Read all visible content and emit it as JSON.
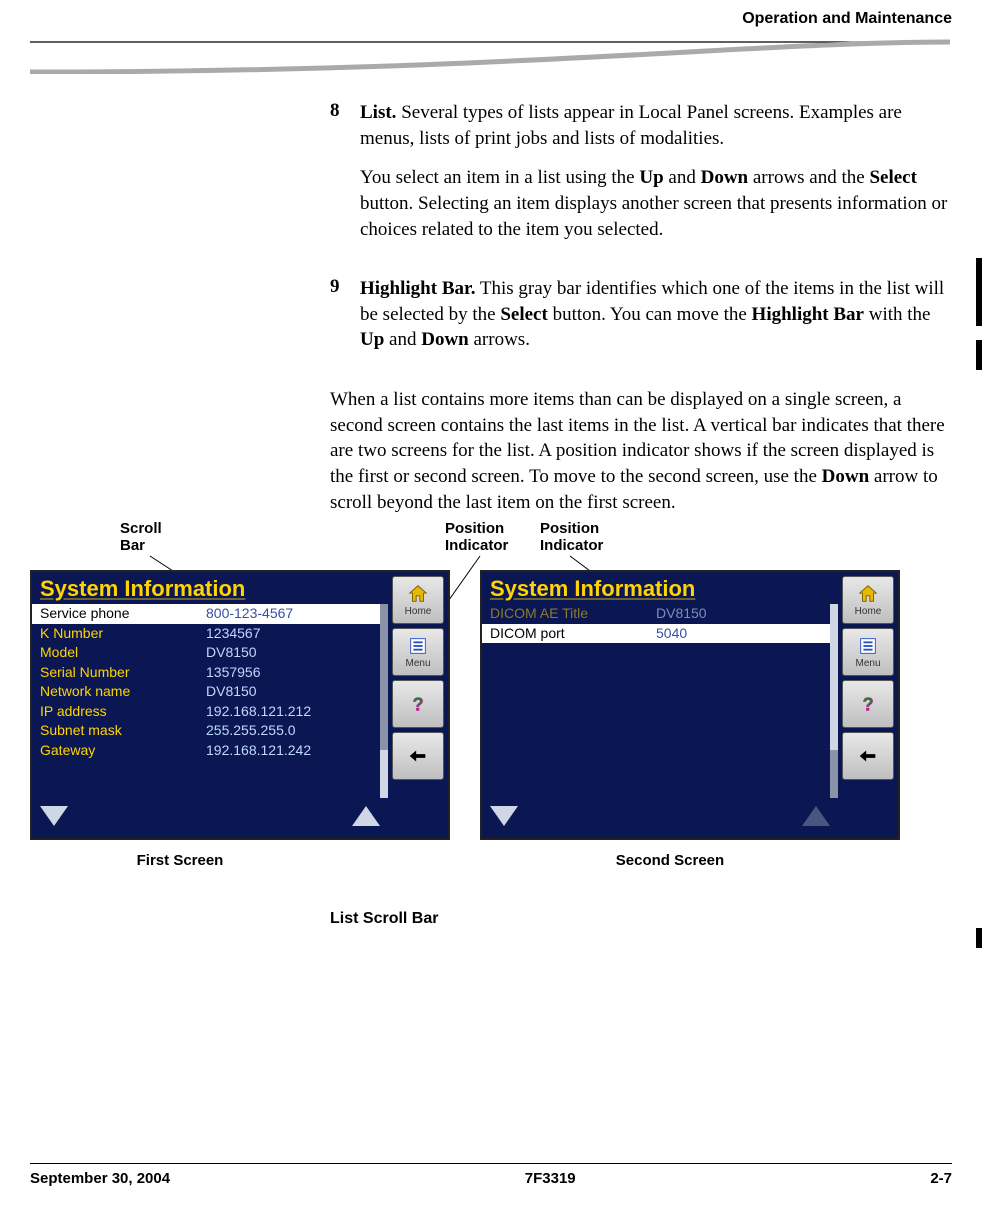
{
  "header": {
    "title": "Operation and Maintenance"
  },
  "items": {
    "item8": {
      "num": "8",
      "title": "List.",
      "p1_rest": " Several types of lists appear in Local Panel screens. Examples are menus, lists of print jobs and lists of modalities.",
      "p2_a": "You select an item in a list using the ",
      "p2_up": "Up",
      "p2_b": " and ",
      "p2_down": "Down",
      "p2_c": " arrows and the ",
      "p2_select": "Select",
      "p2_d": " button. Selecting an item displays another screen that presents information or choices related to the item you selected."
    },
    "item9": {
      "num": "9",
      "title": "Highlight Bar.",
      "p1_a": " This gray bar identifies which one of the items in the list will be selected by the ",
      "p1_select": "Select",
      "p1_b": " button. You can move the ",
      "p1_hb": "Highlight Bar",
      "p1_c": " with the ",
      "p1_up": "Up",
      "p1_d": " and ",
      "p1_down": "Down",
      "p1_e": " arrows."
    },
    "para": {
      "a": "When a list contains more items than can be displayed on a single screen, a second screen contains the last items in the list. A vertical bar indicates that there are two screens for the list. A position indicator shows if the screen displayed is the first or second screen. To move to the second screen, use the ",
      "down": "Down",
      "b": " arrow to scroll beyond the last item on the first screen."
    }
  },
  "callouts": {
    "scroll_bar_l1": "Scroll",
    "scroll_bar_l2": "Bar",
    "pos_ind1_l1": "Position",
    "pos_ind1_l2": "Indicator",
    "pos_ind2_l1": "Position",
    "pos_ind2_l2": "Indicator"
  },
  "screens": {
    "first": {
      "title": "System Information",
      "rows": [
        {
          "label": "Service phone",
          "value": "800-123-4567",
          "selected": true
        },
        {
          "label": "K Number",
          "value": "1234567"
        },
        {
          "label": "Model",
          "value": "DV8150"
        },
        {
          "label": "Serial Number",
          "value": "1357956"
        },
        {
          "label": "Network name",
          "value": "DV8150"
        },
        {
          "label": "IP address",
          "value": "192.168.121.212"
        },
        {
          "label": "Subnet mask",
          "value": "255.255.255.0"
        },
        {
          "label": "Gateway",
          "value": "192.168.121.242"
        }
      ],
      "caption": "First Screen"
    },
    "second": {
      "title": "System Information",
      "rows": [
        {
          "label": "DICOM AE Title",
          "value": "DV8150",
          "dim": true
        },
        {
          "label": "DICOM port",
          "value": "5040",
          "selected": true
        }
      ],
      "caption": "Second Screen"
    },
    "side_buttons": {
      "home": "Home",
      "menu": "Menu"
    }
  },
  "figure_caption": "List Scroll Bar",
  "footer": {
    "date": "September 30, 2004",
    "docnum": "7F3319",
    "page": "2-7"
  }
}
